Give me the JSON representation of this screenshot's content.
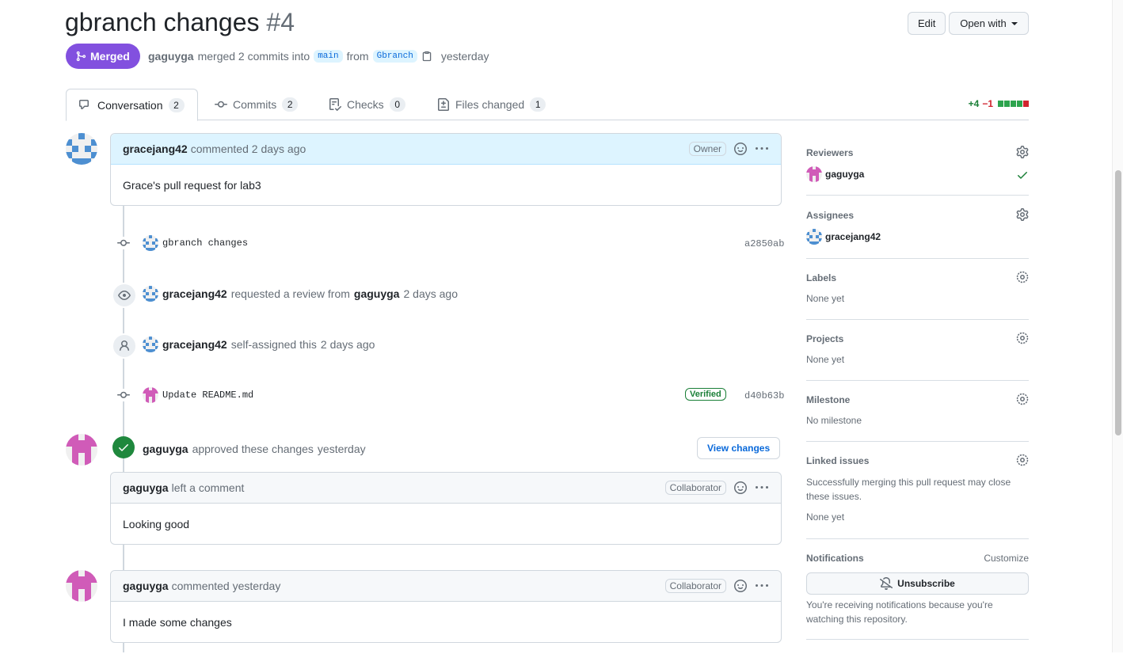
{
  "header": {
    "title": "gbranch changes",
    "number": "#4",
    "edit_label": "Edit",
    "open_with_label": "Open with"
  },
  "state": {
    "label": "Merged",
    "color": "#8250df"
  },
  "meta": {
    "author": "gaguyga",
    "action": "merged 2 commits into",
    "base_branch": "main",
    "from_word": "from",
    "head_branch": "Gbranch",
    "time": "yesterday"
  },
  "tabs": [
    {
      "label": "Conversation",
      "count": "2"
    },
    {
      "label": "Commits",
      "count": "2"
    },
    {
      "label": "Checks",
      "count": "0"
    },
    {
      "label": "Files changed",
      "count": "1"
    }
  ],
  "diffstat": {
    "additions": "+4",
    "deletions": "−1",
    "add_blocks": 4,
    "del_blocks": 1
  },
  "timeline": {
    "opening_comment": {
      "author": "gracejang42",
      "action": "commented",
      "time": "2 days ago",
      "badge": "Owner",
      "body": "Grace's pull request for lab3"
    },
    "commit1": {
      "message": "gbranch changes",
      "sha": "a2850ab"
    },
    "review_request": {
      "actor": "gracejang42",
      "text": "requested a review from",
      "target": "gaguyga",
      "time": "2 days ago"
    },
    "self_assign": {
      "actor": "gracejang42",
      "text": "self-assigned this",
      "time": "2 days ago"
    },
    "commit2": {
      "message": "Update README.md",
      "verified": "Verified",
      "sha": "d40b63b"
    },
    "approval": {
      "actor": "gaguyga",
      "text": "approved these changes",
      "time": "yesterday",
      "button": "View changes"
    },
    "review_comment": {
      "author": "gaguyga",
      "action": "left a comment",
      "badge": "Collaborator",
      "body": "Looking good"
    },
    "last_comment": {
      "author": "gaguyga",
      "action": "commented",
      "time": "yesterday",
      "badge": "Collaborator",
      "body": "I made some changes"
    }
  },
  "sidebar": {
    "reviewers": {
      "title": "Reviewers",
      "user": "gaguyga"
    },
    "assignees": {
      "title": "Assignees",
      "user": "gracejang42"
    },
    "labels": {
      "title": "Labels",
      "value": "None yet"
    },
    "projects": {
      "title": "Projects",
      "value": "None yet"
    },
    "milestone": {
      "title": "Milestone",
      "value": "No milestone"
    },
    "linked_issues": {
      "title": "Linked issues",
      "description": "Successfully merging this pull request may close these issues.",
      "value": "None yet"
    },
    "notifications": {
      "title": "Notifications",
      "customize": "Customize",
      "button": "Unsubscribe",
      "note": "You're receiving notifications because you're watching this repository."
    }
  }
}
